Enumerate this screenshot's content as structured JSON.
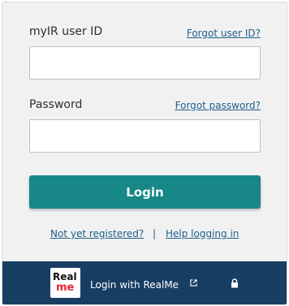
{
  "form": {
    "user_id_label": "myIR user ID",
    "forgot_user_id": "Forgot user ID?",
    "user_id_value": "",
    "password_label": "Password",
    "forgot_password": "Forgot password?",
    "password_value": "",
    "login_label": "Login",
    "not_registered": "Not yet registered?",
    "separator": "|",
    "help_logging_in": "Help logging in"
  },
  "footer": {
    "logo_text_top": "Real",
    "logo_text_bottom": "me",
    "realme_link": "Login with RealMe",
    "external_icon": "external-link-icon",
    "lock_icon": "lock-icon"
  },
  "colors": {
    "accent": "#178787",
    "link": "#1e5e89",
    "footer_bg": "#173e63",
    "panel_bg": "#f1f1f1"
  }
}
